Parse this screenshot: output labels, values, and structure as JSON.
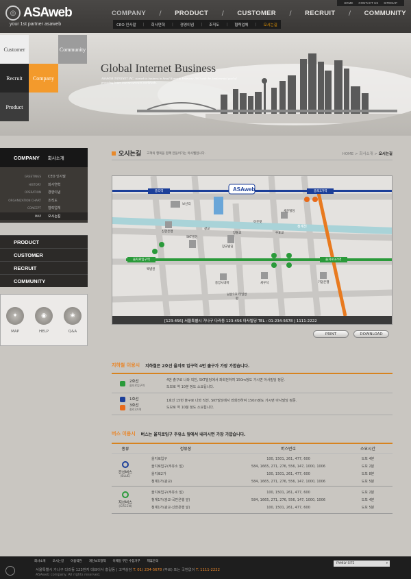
{
  "brand": {
    "name": "ASAweb",
    "tagline": "your 1st partner asaweb"
  },
  "util": [
    "HOME",
    "CONTACT US",
    "SITEMAP"
  ],
  "gnb": [
    "COMPANY",
    "PRODUCT",
    "CUSTOMER",
    "RECRUIT",
    "COMMUNITY"
  ],
  "subnav": [
    "CEO 인사말",
    "회사연혁",
    "경영이념",
    "조직도",
    "협력업체",
    "오시는길"
  ],
  "quick": {
    "customer": "Customer",
    "community": "Community",
    "recruit": "Recruit",
    "company": "Company",
    "product": "Product"
  },
  "visual": {
    "slogan": "Global Internet Business",
    "sub": "ASAWEB INTERNET INC. started its business in Seoul Korea in February 2000 with the fundamental goal of providing better internet services worldwide."
  },
  "lnb": {
    "title_en": "COMPANY",
    "title_ko": "회사소개",
    "items": [
      {
        "en": "GREETINGS",
        "ko": "CEO 인사말"
      },
      {
        "en": "HISTORY",
        "ko": "회사연혁"
      },
      {
        "en": "OPERATION",
        "ko": "경영이념"
      },
      {
        "en": "ORGANIZATION CHART",
        "ko": "조직도"
      },
      {
        "en": "CONCEPT",
        "ko": "협력업체"
      },
      {
        "en": "MAP",
        "ko": "오시는길"
      }
    ],
    "main": [
      "PRODUCT",
      "CUSTOMER",
      "RECRUIT",
      "COMMUNITY"
    ],
    "icons": [
      "MAP",
      "HELP",
      "Q&A"
    ]
  },
  "content": {
    "title": "오시는길",
    "desc": "고객의 행복을 함께 만들어가는 아사웹입니다.",
    "crumb": [
      "HOME",
      "회사소개",
      "오시는길"
    ]
  },
  "map": {
    "labels": {
      "station1": "종각역",
      "station2": "종로3가역",
      "station3": "을지로입구역",
      "station4": "을지로3가역",
      "stream": "청계천",
      "bldg1": "보신각",
      "bldg2": "신한은행",
      "bldg3": "SKT빌딩",
      "bldg4": "장교빌딩",
      "bldg5": "광교",
      "bldg6": "장통교",
      "bldg7": "수표교",
      "bldg8": "세운빌딩",
      "bldg9": "중앙시네마",
      "bldg10": "세우석",
      "bldg11": "남산1호 터널방향",
      "bldg12": "기업은행",
      "bldg13": "백병원",
      "bldg14": "아웃렛"
    },
    "address": "[123-456] 서울특별시 가나구 다라동 123-456 아사빌딩    TEL : 01-234-5678  |  1111-2222",
    "print": "PRINT",
    "download": "DOWNLOAD"
  },
  "subway": {
    "title": "지하철 이용시",
    "lead": "지하철은 2호선 을지로 입구역 4번 출구가 가장 가깝습니다.",
    "rows": [
      {
        "line": "2호선",
        "station": "을지로입구역",
        "color": "#2a9a3a",
        "desc1": "4번 출구로 나와 직진, SKT빌딩에서 좌회전하여 150m정도 가시면 아사빌딩 정문.",
        "desc2": "도보로 약 10분 정도 소요됩니다."
      },
      {
        "line": "1호선",
        "station": "",
        "color": "#1c3f99",
        "line2": "3호선",
        "station2": "종로3가역",
        "color2": "#e86a1a",
        "desc1": "1호선 15번 출구로 나와 직진, SKT빌딩에서 좌회전하여 150m정도 가시면 아사빌딩 정문.",
        "desc2": "도보로 약 10분 정도 소요됩니다."
      }
    ]
  },
  "bus": {
    "title": "버스 이용시",
    "lead": "버스는 을지로입구 주유소 앞에서 내리시면 가장 가깝습니다.",
    "headers": [
      "종류",
      "정류장",
      "버스번호",
      "소요시간"
    ],
    "groups": [
      {
        "type": "간선버스",
        "sub": "(BLUE)",
        "color": "#1c3f99",
        "rows": [
          [
            "을지로입구",
            "100, 1501, 261, 477, 600",
            "도보 4분"
          ],
          [
            "을지로입구(주유소 앞)",
            "584, 1665, 271, 276, 556, 147, 1000, 1006",
            "도보 2분"
          ],
          [
            "을지로2가",
            "100, 1501, 261, 477, 600",
            "도보 8분"
          ],
          [
            "청계1가(광교)",
            "584, 1665, 271, 276, 556, 147, 1000, 1006",
            "도보 5분"
          ]
        ]
      },
      {
        "type": "지선버스",
        "sub": "(GREEN)",
        "color": "#2a9a3a",
        "rows": [
          [
            "을지로입구(주유소 앞)",
            "100, 1501, 261, 477, 600",
            "도보 2분"
          ],
          [
            "청계1가(광교-국민은행 앞)",
            "584, 1665, 271, 276, 556, 147, 1000, 1006",
            "도보 4분"
          ],
          [
            "청계1가(광교-신한은행 앞)",
            "100, 1501, 261, 477, 600",
            "도보 5분"
          ]
        ]
      }
    ]
  },
  "footer": {
    "links": [
      "회사소개",
      "오시는길",
      "이용약관",
      "개인보호정책",
      "이메일 무단 수집거부",
      "제휴문의"
    ],
    "address": "서울특별시 가나구 다라동 123번지 대표이사 홍길동 | 고객상담",
    "tel": "T. 01) 234-5678",
    "addr_mid": "(무료) 또는 국번없이",
    "tel2": "T. 1111-2222",
    "copy": "ASAweb company. All rights reserved.",
    "family": "FAMILY SITE"
  }
}
